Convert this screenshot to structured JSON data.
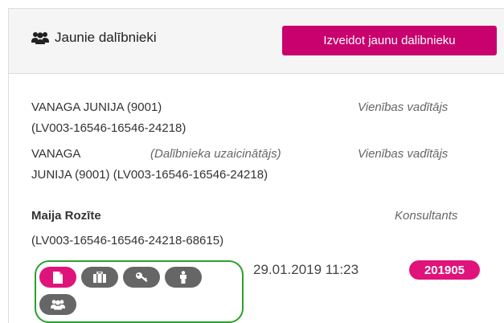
{
  "header": {
    "title": "Jaunie dalībnieki",
    "create_button": "Izveidot jaunu dalibnieku",
    "icon": "users-icon"
  },
  "entries": [
    {
      "line1": "VANAGA JUNIJA (9001)",
      "line2": "(LV003-16546-16546-24218)",
      "role": "Vienības vadītājs"
    },
    {
      "line1a": "VANAGA",
      "line1b": "(Dalībnieka uzaicinātājs)",
      "line2": "JUNIJA (9001) (LV003-16546-16546-24218)",
      "role": "Vienības vadītājs"
    },
    {
      "name": "Maija Rozīte",
      "line2": "(LV003-16546-16546-24218-68615)",
      "role": "Konsultants",
      "datetime": "29.01.2019 11:23",
      "badge": "201905",
      "actions": [
        {
          "icon": "document-icon",
          "active": true
        },
        {
          "icon": "briefcase-icon",
          "active": false
        },
        {
          "icon": "key-icon",
          "active": false
        },
        {
          "icon": "person-icon",
          "active": false
        },
        {
          "icon": "users-icon",
          "active": false
        }
      ]
    }
  ],
  "colors": {
    "accent": "#c8016e",
    "badge": "#e0137b",
    "action_default": "#666666",
    "highlight_outline": "#2ca02c"
  }
}
